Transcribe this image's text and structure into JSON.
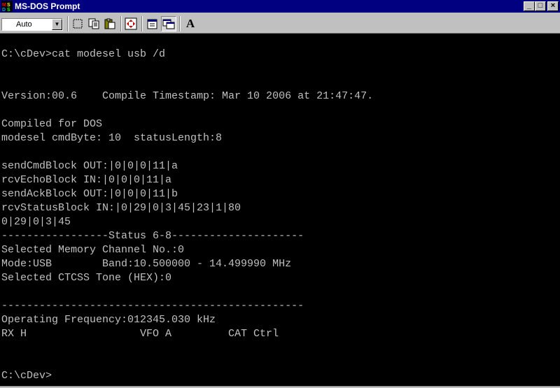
{
  "window": {
    "title": "MS-DOS Prompt",
    "title_bar_color": "#000080",
    "icon": "msdos-app-icon",
    "controls": {
      "minimize": "_",
      "maximize": "□",
      "close": "×"
    }
  },
  "toolbar": {
    "font_size": "Auto",
    "buttons": [
      "mark-icon",
      "copy-icon",
      "paste-icon",
      "fullscreen-icon",
      "properties-icon",
      "background-icon",
      "font-icon"
    ],
    "font_button_label": "A"
  },
  "console": {
    "background": "#000000",
    "foreground": "#c0c0c0",
    "lines": [
      "C:\\cDev>cat modesel usb /d",
      "Version:00.6    Compile Timestamp: Mar 10 2006 at 21:47:47.",
      "Compiled for DOS",
      "modesel cmdByte: 10  statusLength:8",
      "sendCmdBlock OUT:|0|0|0|11|a",
      "rcvEchoBlock IN:|0|0|0|11|a",
      "sendAckBlock OUT:|0|0|0|11|b",
      "rcvStatusBlock IN:|0|29|0|3|45|23|1|80",
      "0|29|0|3|45",
      "-----------------Status 6-8---------------------",
      "Selected Memory Channel No.:0",
      "Mode:USB        Band:10.500000 - 14.499990 MHz",
      "Selected CTCSS Tone (HEX):0",
      "------------------------------------------------",
      "Operating Frequency:012345.030 kHz",
      "RX H                  VFO A         CAT Ctrl",
      "C:\\cDev>"
    ]
  }
}
